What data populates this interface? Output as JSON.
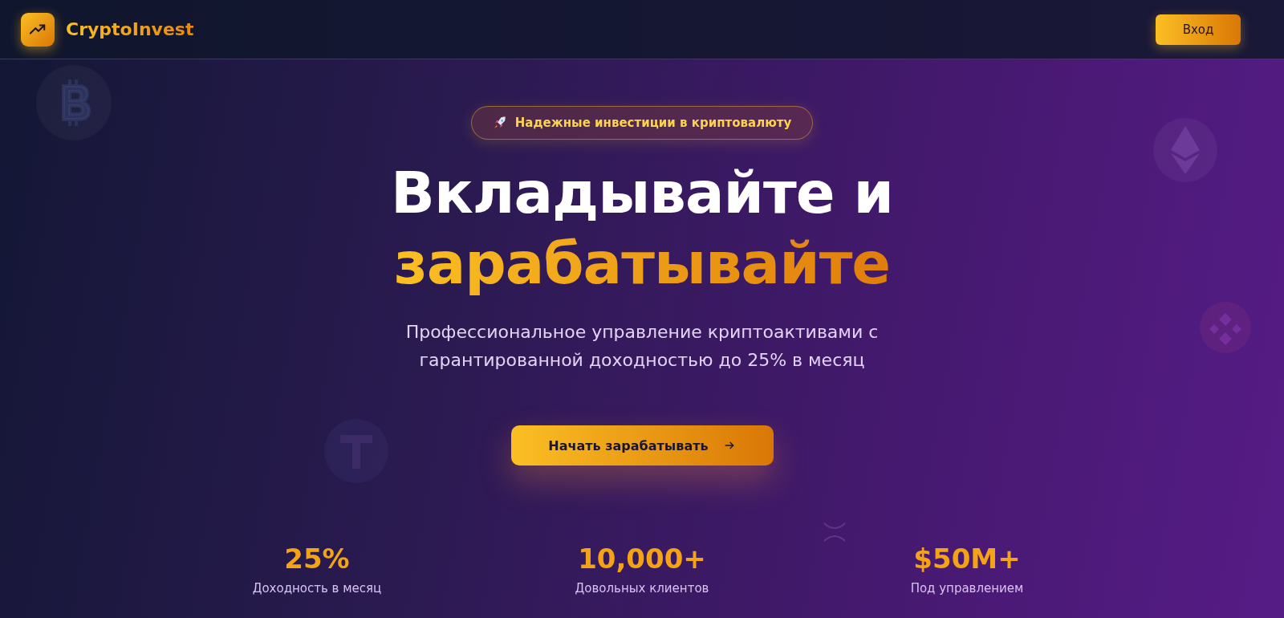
{
  "header": {
    "brand": "CryptoInvest",
    "login_button": "Вход"
  },
  "hero": {
    "badge": "Надежные инвестиции в криптовалюту",
    "title_line_1": "Вкладывайте и",
    "title_line_2": "зарабатывайте",
    "subtitle": "Профессиональное управление криптоактивами с гарантированной доходностью до 25% в месяц",
    "cta": "Начать зарабатывать"
  },
  "stats": [
    {
      "value": "25%",
      "label": "Доходность в месяц"
    },
    {
      "value": "10,000+",
      "label": "Довольных клиентов"
    },
    {
      "value": "$50M+",
      "label": "Под управлением"
    }
  ]
}
